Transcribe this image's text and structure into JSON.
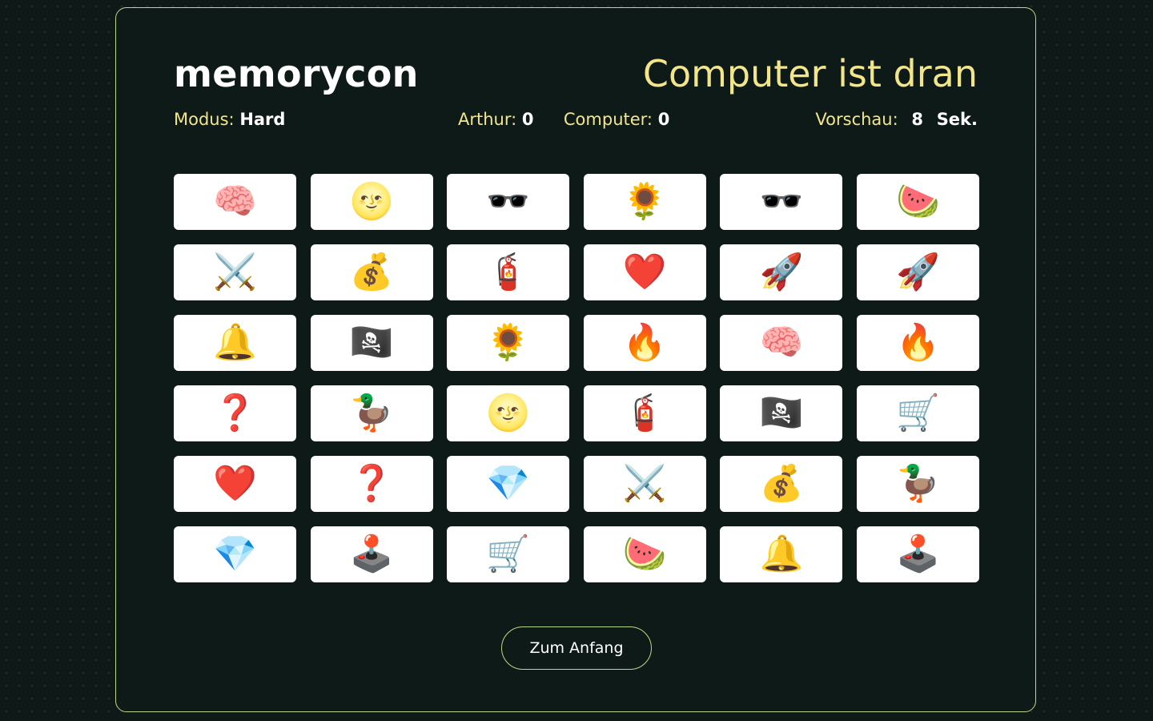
{
  "header": {
    "title": "memorycon",
    "turn_status": "Computer ist dran"
  },
  "info": {
    "mode_label": "Modus:",
    "mode_value": "Hard",
    "player1_label": "Arthur:",
    "player1_score": "0",
    "player2_label": "Computer:",
    "player2_score": "0",
    "preview_label": "Vorschau:",
    "preview_seconds": "8",
    "preview_unit": "Sek."
  },
  "board": {
    "columns": 6,
    "cards": [
      {
        "symbol": "🧠",
        "icon": "brain-icon"
      },
      {
        "symbol": "🌝",
        "icon": "full-moon-face-icon"
      },
      {
        "symbol": "🕶️",
        "icon": "sunglasses-icon"
      },
      {
        "symbol": "🌻",
        "icon": "sunflower-icon"
      },
      {
        "symbol": "🕶️",
        "icon": "sunglasses-icon"
      },
      {
        "symbol": "🍉",
        "icon": "watermelon-icon"
      },
      {
        "symbol": "⚔️",
        "icon": "crossed-swords-icon"
      },
      {
        "symbol": "💰",
        "icon": "money-bag-icon"
      },
      {
        "symbol": "🧯",
        "icon": "fire-extinguisher-icon"
      },
      {
        "symbol": "❤️",
        "icon": "red-heart-icon"
      },
      {
        "symbol": "🚀",
        "icon": "rocket-icon"
      },
      {
        "symbol": "🚀",
        "icon": "rocket-icon"
      },
      {
        "symbol": "🔔",
        "icon": "bell-icon"
      },
      {
        "symbol": "🏴‍☠️",
        "icon": "pirate-flag-icon"
      },
      {
        "symbol": "🌻",
        "icon": "sunflower-icon"
      },
      {
        "symbol": "🔥",
        "icon": "fire-icon"
      },
      {
        "symbol": "🧠",
        "icon": "brain-icon"
      },
      {
        "symbol": "🔥",
        "icon": "fire-icon"
      },
      {
        "symbol": "❓",
        "icon": "question-mark-icon"
      },
      {
        "symbol": "🦆",
        "icon": "duck-icon"
      },
      {
        "symbol": "🌝",
        "icon": "full-moon-face-icon"
      },
      {
        "symbol": "🧯",
        "icon": "fire-extinguisher-icon"
      },
      {
        "symbol": "🏴‍☠️",
        "icon": "pirate-flag-icon"
      },
      {
        "symbol": "🛒",
        "icon": "shopping-cart-icon"
      },
      {
        "symbol": "❤️",
        "icon": "red-heart-icon"
      },
      {
        "symbol": "❓",
        "icon": "question-mark-icon"
      },
      {
        "symbol": "💎",
        "icon": "gem-icon"
      },
      {
        "symbol": "⚔️",
        "icon": "crossed-swords-icon"
      },
      {
        "symbol": "💰",
        "icon": "money-bag-icon"
      },
      {
        "symbol": "🦆",
        "icon": "duck-icon"
      },
      {
        "symbol": "💎",
        "icon": "gem-icon"
      },
      {
        "symbol": "🕹️",
        "icon": "joystick-icon"
      },
      {
        "symbol": "🛒",
        "icon": "shopping-cart-icon"
      },
      {
        "symbol": "🍉",
        "icon": "watermelon-icon"
      },
      {
        "symbol": "🔔",
        "icon": "bell-icon"
      },
      {
        "symbol": "🕹️",
        "icon": "joystick-icon"
      }
    ]
  },
  "footer": {
    "start_button_label": "Zum Anfang"
  },
  "colors": {
    "background": "#0f1a18",
    "panel_border": "#b9d98a",
    "accent_text": "#f3e68a",
    "card": "#ffffff"
  }
}
